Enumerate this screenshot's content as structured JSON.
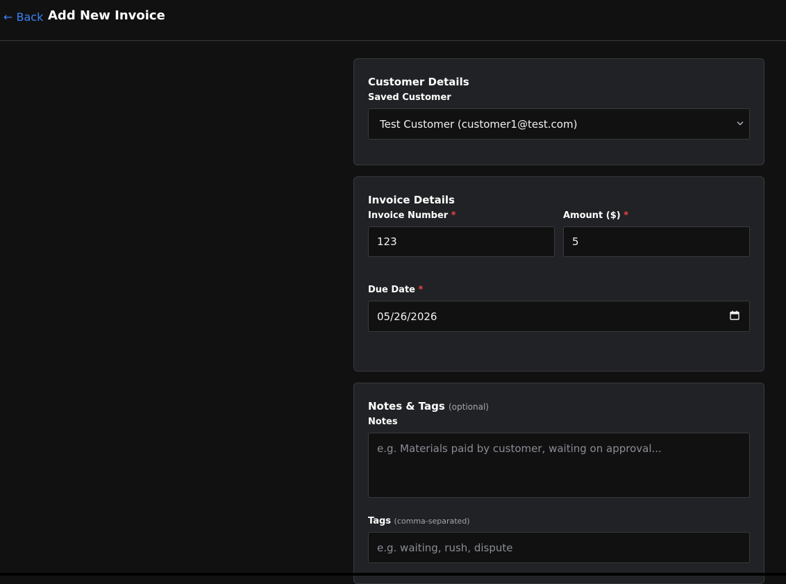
{
  "header": {
    "back_label": "← Back",
    "title": "Add New Invoice"
  },
  "customer_card": {
    "title": "Customer Details",
    "saved_customer_label": "Saved Customer",
    "saved_customer_value": "Test Customer (customer1@test.com)"
  },
  "invoice_card": {
    "title": "Invoice Details",
    "invoice_number_label": "Invoice Number",
    "invoice_number_value": "123",
    "amount_label": "Amount ($)",
    "amount_value": "5",
    "due_date_label": "Due Date",
    "due_date_value": "05/26/2026",
    "required_marker": "*"
  },
  "notes_card": {
    "title": "Notes & Tags",
    "title_hint": "(optional)",
    "notes_label": "Notes",
    "notes_placeholder": "e.g. Materials paid by customer, waiting on approval...",
    "tags_label": "Tags",
    "tags_hint": "(comma-separated)",
    "tags_placeholder": "e.g. waiting, rush, dispute"
  },
  "colors": {
    "accent": "#3b82f6",
    "required": "#ef4444",
    "card_bg": "#212225",
    "page_bg": "#111112"
  },
  "icons": {
    "select": "chevron-down-icon",
    "date": "calendar-icon"
  }
}
